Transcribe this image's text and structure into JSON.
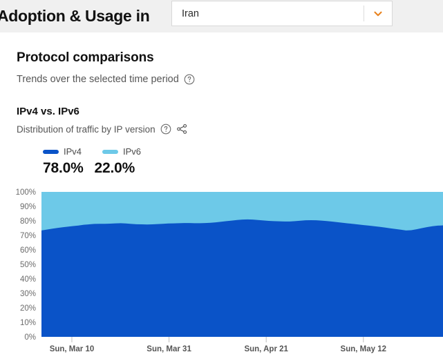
{
  "header": {
    "title": "Adoption & Usage in",
    "country_select": {
      "value": "Iran",
      "chevron_icon": "chevron-down-icon",
      "accent": "#E8821E"
    }
  },
  "section": {
    "title": "Protocol comparisons",
    "subtitle": "Trends over the selected time period",
    "help_icon": "help-circle-icon"
  },
  "card": {
    "title": "IPv4 vs. IPv6",
    "subtitle": "Distribution of traffic by IP version",
    "help_icon": "help-circle-icon",
    "share_icon": "share-icon"
  },
  "legend": {
    "items": [
      {
        "label": "IPv4",
        "value": "78.0%",
        "color": "#0A53C8"
      },
      {
        "label": "IPv6",
        "value": "22.0%",
        "color": "#6DC9E8"
      }
    ]
  },
  "chart_data": {
    "type": "area",
    "stacked": true,
    "title": "IPv4 vs. IPv6",
    "subtitle": "Distribution of traffic by IP version",
    "xlabel": "",
    "ylabel": "",
    "ylim": [
      0,
      100
    ],
    "grid": false,
    "legend_position": "top-left",
    "ytick_labels": [
      "100%",
      "90%",
      "80%",
      "70%",
      "60%",
      "50%",
      "40%",
      "30%",
      "20%",
      "10%",
      "0%"
    ],
    "ytick_values": [
      100,
      90,
      80,
      70,
      60,
      50,
      40,
      30,
      20,
      10,
      0
    ],
    "xtick_labels": [
      "Sun, Mar 10",
      "Sun, Mar 31",
      "Sun, Apr 21",
      "Sun, May 12"
    ],
    "xtick_positions": [
      0.0757,
      0.3177,
      0.5597,
      0.8017
    ],
    "x": [
      0,
      1,
      2,
      3,
      4,
      5,
      6,
      7,
      8,
      9,
      10,
      11,
      12,
      13,
      14,
      15,
      16,
      17,
      18,
      19,
      20,
      21,
      22,
      23,
      24,
      25,
      26,
      27,
      28,
      29,
      30,
      31,
      32,
      33,
      34,
      35,
      36,
      37,
      38,
      39,
      40,
      41,
      42,
      43,
      44,
      45,
      46,
      47,
      48,
      49,
      50,
      51,
      52,
      53,
      54,
      55,
      56,
      57,
      58,
      59,
      60,
      61,
      62,
      63,
      64,
      65,
      66,
      67,
      68,
      69,
      70,
      71,
      72,
      73,
      74,
      75,
      76
    ],
    "series": [
      {
        "name": "IPv4",
        "color": "#0A53C8",
        "current_value": 78.0,
        "values": [
          73.4,
          74.0,
          74.6,
          75.1,
          75.6,
          76.0,
          76.4,
          76.8,
          77.3,
          77.6,
          77.9,
          78.0,
          78.0,
          78.1,
          78.3,
          78.4,
          78.2,
          77.9,
          77.7,
          77.6,
          77.5,
          77.6,
          77.8,
          78.0,
          78.2,
          78.3,
          78.4,
          78.5,
          78.5,
          78.4,
          78.4,
          78.5,
          78.7,
          79.0,
          79.4,
          79.8,
          80.2,
          80.6,
          80.9,
          81.0,
          80.9,
          80.6,
          80.3,
          80.0,
          79.8,
          79.7,
          79.6,
          79.6,
          79.8,
          80.1,
          80.4,
          80.5,
          80.4,
          80.2,
          79.9,
          79.5,
          79.1,
          78.7,
          78.3,
          77.9,
          77.5,
          77.1,
          76.7,
          76.3,
          75.9,
          75.4,
          74.9,
          74.4,
          73.9,
          73.4,
          73.6,
          74.2,
          75.0,
          75.7,
          76.3,
          76.7,
          76.9
        ]
      },
      {
        "name": "IPv6",
        "color": "#6DC9E8",
        "current_value": 22.0,
        "values": [
          26.6,
          26.0,
          25.4,
          24.9,
          24.4,
          24.0,
          23.6,
          23.2,
          22.7,
          22.4,
          22.1,
          22.0,
          22.0,
          21.9,
          21.7,
          21.6,
          21.8,
          22.1,
          22.3,
          22.4,
          22.5,
          22.4,
          22.2,
          22.0,
          21.8,
          21.7,
          21.6,
          21.5,
          21.5,
          21.6,
          21.6,
          21.5,
          21.3,
          21.0,
          20.6,
          20.2,
          19.8,
          19.4,
          19.1,
          19.0,
          19.1,
          19.4,
          19.7,
          20.0,
          20.2,
          20.3,
          20.4,
          20.4,
          20.2,
          19.9,
          19.6,
          19.5,
          19.6,
          19.8,
          20.1,
          20.5,
          20.9,
          21.3,
          21.7,
          22.1,
          22.5,
          22.9,
          23.3,
          23.7,
          24.1,
          24.6,
          25.1,
          25.6,
          26.1,
          26.6,
          26.4,
          25.8,
          25.0,
          24.3,
          23.7,
          23.3,
          23.1
        ]
      }
    ]
  }
}
